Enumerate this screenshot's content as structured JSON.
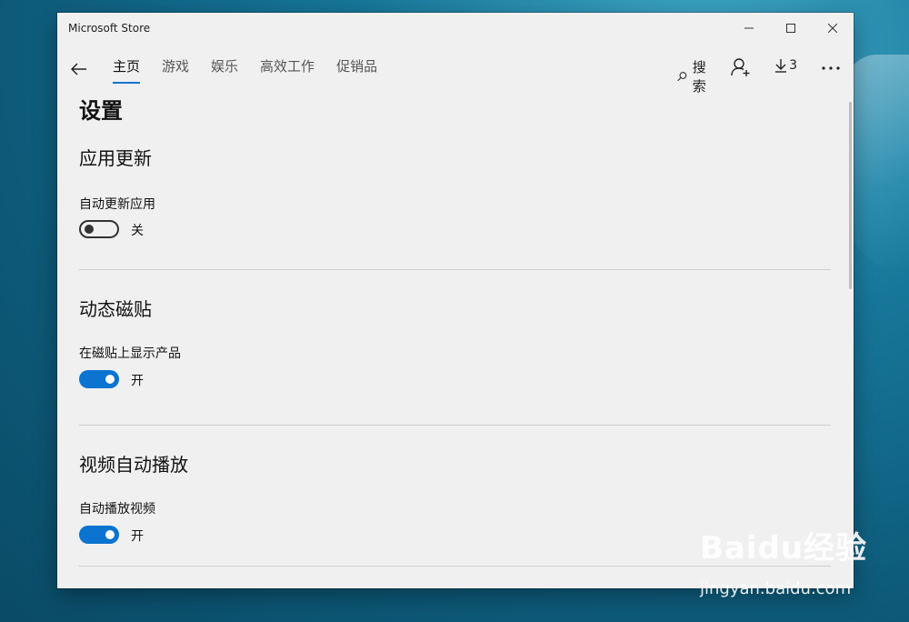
{
  "window": {
    "app_title": "Microsoft Store",
    "controls": {
      "minimize": "minimize-icon",
      "maximize": "maximize-icon",
      "close": "close-icon"
    }
  },
  "nav": {
    "tabs": [
      {
        "label": "主页",
        "active": true
      },
      {
        "label": "游戏",
        "active": false
      },
      {
        "label": "娱乐",
        "active": false
      },
      {
        "label": "高效工作",
        "active": false
      },
      {
        "label": "促销品",
        "active": false
      }
    ],
    "search_label": "搜索",
    "downloads_count": "3"
  },
  "page": {
    "title": "设置",
    "sections": [
      {
        "title": "应用更新",
        "setting_label": "自动更新应用",
        "state_label": "关",
        "on": false
      },
      {
        "title": "动态磁贴",
        "setting_label": "在磁贴上显示产品",
        "state_label": "开",
        "on": true
      },
      {
        "title": "视频自动播放",
        "setting_label": "自动播放视频",
        "state_label": "开",
        "on": true
      }
    ]
  },
  "watermark": {
    "logo_text": "Baidu经验",
    "url": "jingyan.baidu.com"
  },
  "colors": {
    "accent": "#0b73d0",
    "window_bg": "#f0f0f0",
    "desktop_bg": "#17779a"
  }
}
